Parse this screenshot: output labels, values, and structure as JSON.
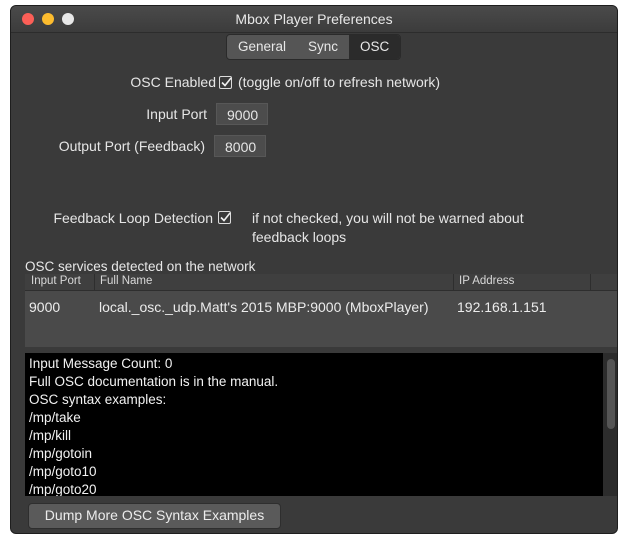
{
  "window": {
    "title": "Mbox Player Preferences"
  },
  "tabs": [
    {
      "label": "General",
      "selected": false
    },
    {
      "label": "Sync",
      "selected": false
    },
    {
      "label": "OSC",
      "selected": true
    }
  ],
  "osc": {
    "enabled_label": "OSC Enabled",
    "enabled_checked": true,
    "enabled_hint": "(toggle on/off to refresh network)",
    "input_port_label": "Input Port",
    "input_port_value": "9000",
    "output_port_label": "Output Port (Feedback)",
    "output_port_value": "8000",
    "feedback_label": "Feedback Loop Detection",
    "feedback_checked": true,
    "feedback_hint_line1": "if not checked, you will not be warned about",
    "feedback_hint_line2": "feedback loops"
  },
  "services": {
    "title": "OSC services detected on the network",
    "columns": [
      "Input Port",
      "Full Name",
      "IP Address"
    ],
    "rows": [
      {
        "input_port": "9000",
        "full_name": "local._osc._udp.Matt's 2015 MBP:9000 (MboxPlayer)",
        "ip": "192.168.1.151"
      }
    ]
  },
  "console": {
    "lines": [
      "Input Message Count: 0",
      "Full OSC documentation is in the manual.",
      "OSC syntax examples:",
      "/mp/take",
      "/mp/kill",
      "/mp/gotoin",
      "/mp/goto10",
      "/mp/goto20"
    ]
  },
  "buttons": {
    "dump_label": "Dump More OSC Syntax Examples"
  },
  "colors": {
    "window_bg": "#3a3a3a",
    "console_bg": "#000000",
    "close": "#fc5f57",
    "minimize": "#fdbc2e"
  }
}
